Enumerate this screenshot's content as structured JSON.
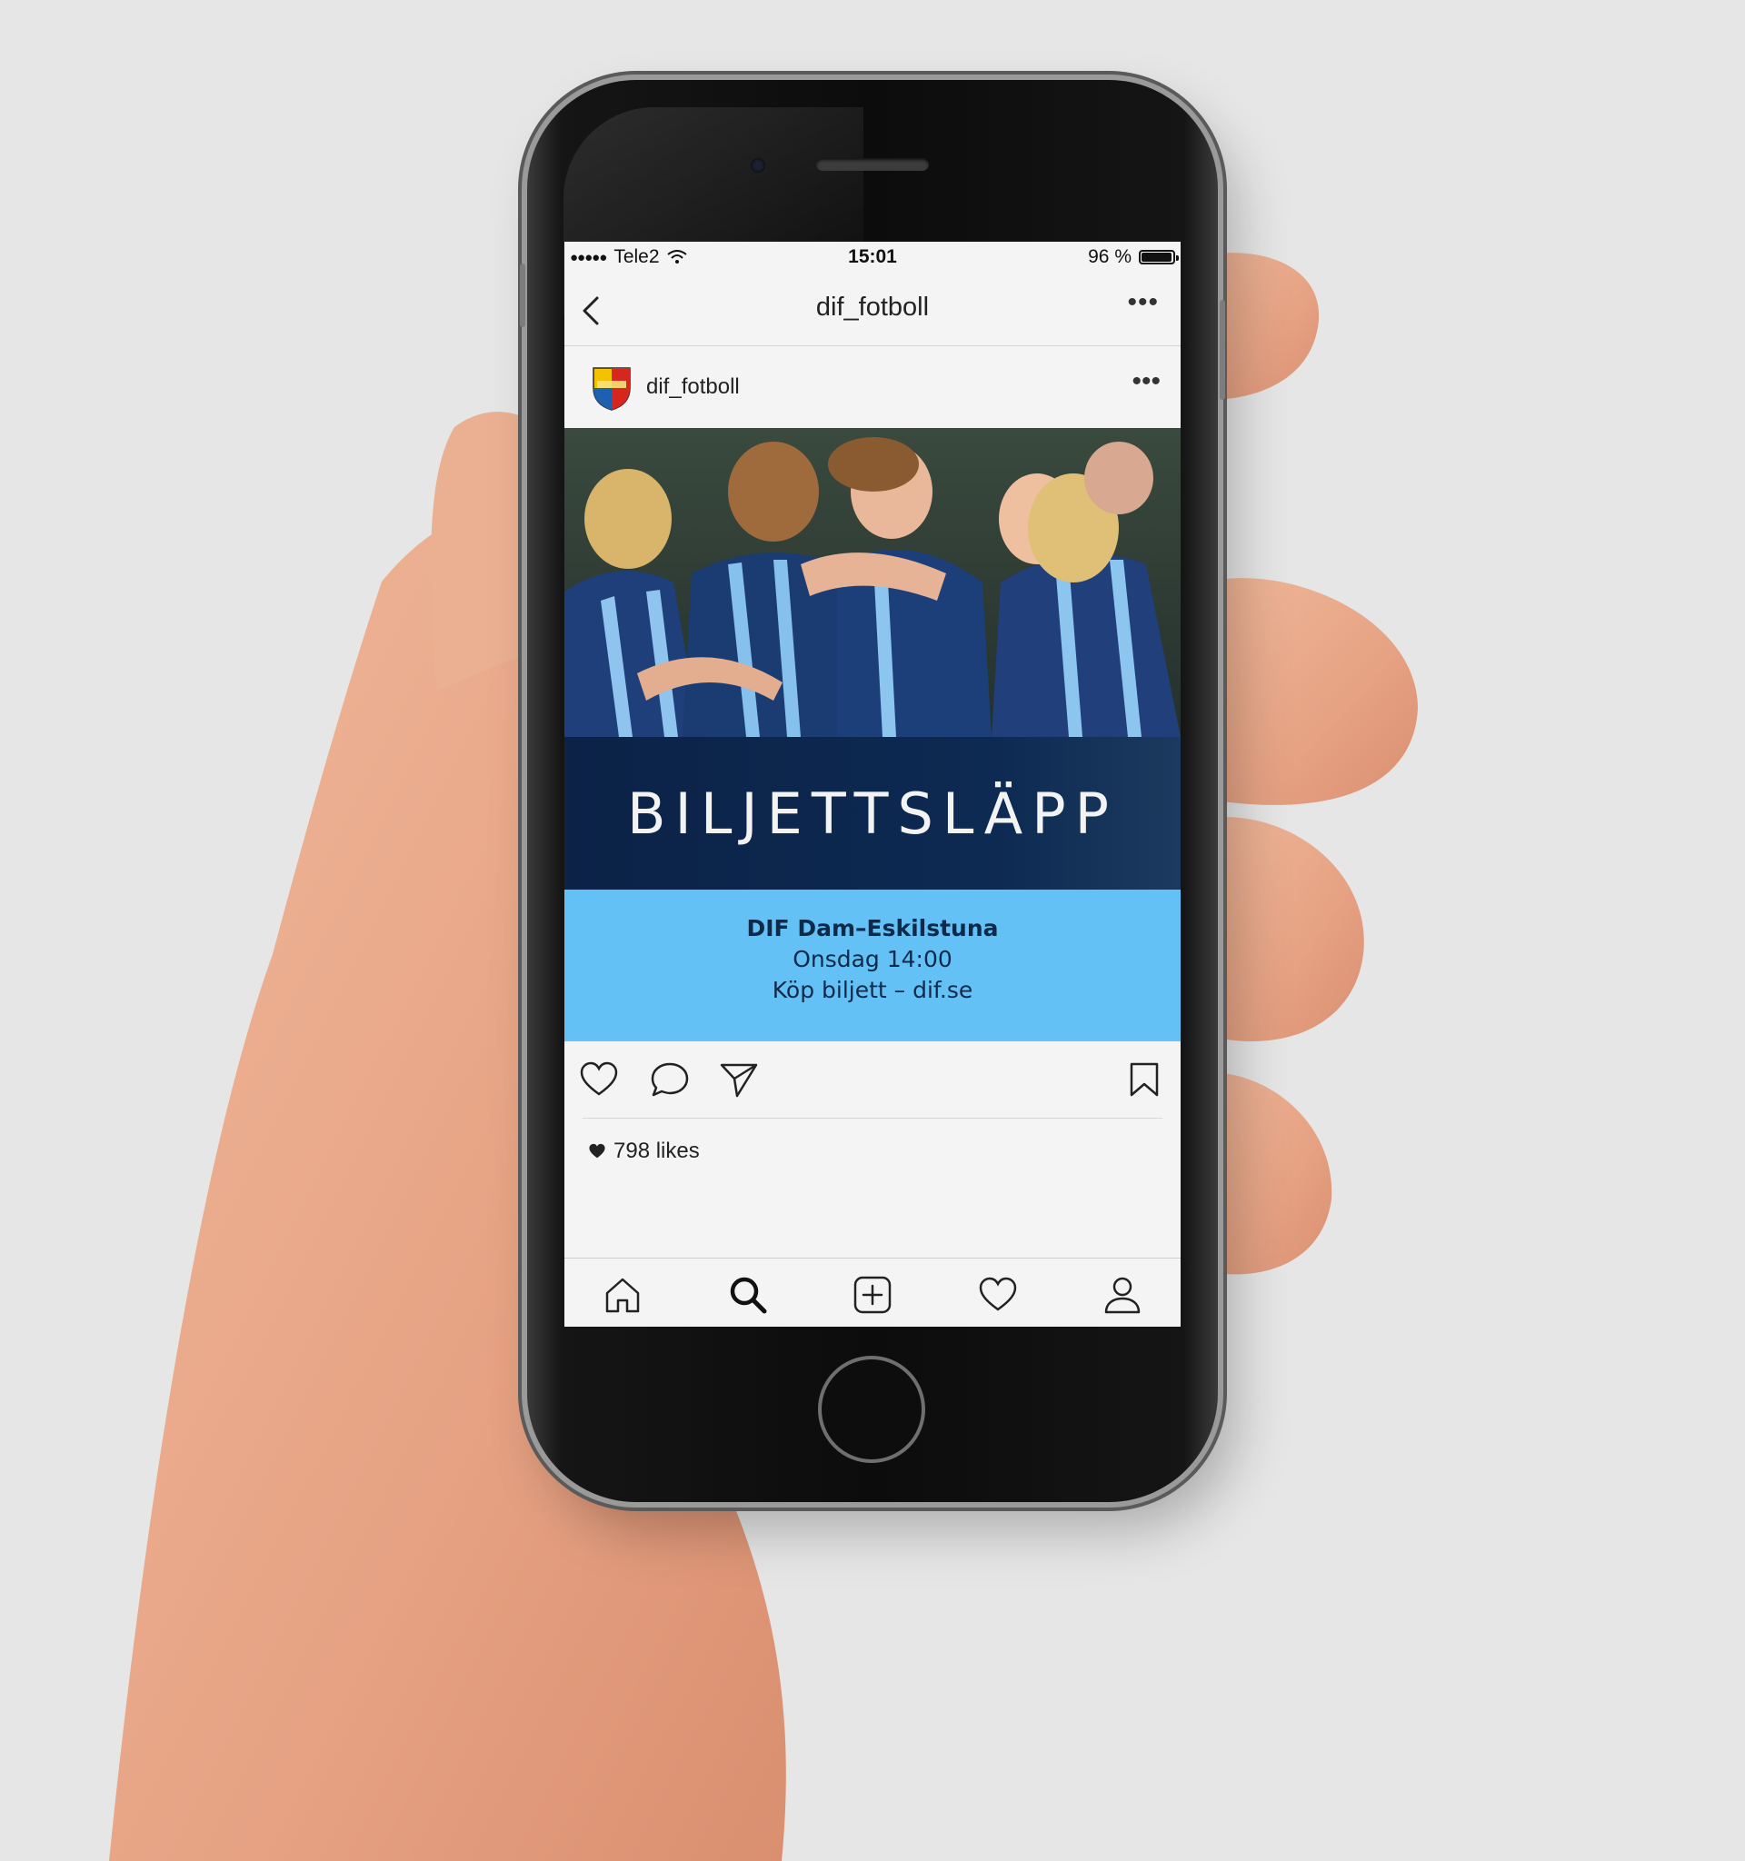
{
  "status_bar": {
    "carrier": "Tele2",
    "time": "15:01",
    "battery_text": "96 %",
    "battery_level": 0.96
  },
  "nav": {
    "title": "dif_fotboll",
    "more": "•••"
  },
  "post": {
    "username": "dif_fotboll",
    "more": "•••",
    "headline": "BILJETTSLÄPP",
    "match_title": "DIF Dam–Eskilstuna",
    "match_time": "Onsdag 14:00",
    "match_cta": "Köp biljett – dif.se",
    "likes": "798 likes"
  },
  "colors": {
    "navy": "#0c2247",
    "sky_blue": "#63c1f6",
    "background": "#e6e6e6"
  },
  "icons": {
    "actions": [
      "heart-icon",
      "comment-icon",
      "share-icon",
      "bookmark-icon"
    ],
    "tabs": [
      "home-icon",
      "search-icon",
      "add-icon",
      "activity-icon",
      "profile-icon"
    ]
  }
}
